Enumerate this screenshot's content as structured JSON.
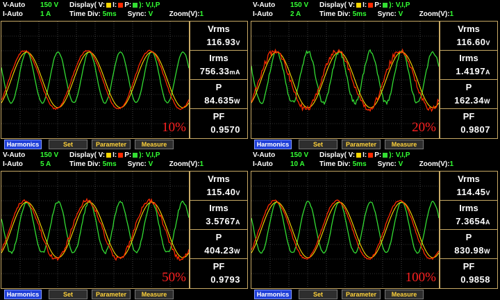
{
  "panels": [
    {
      "v_range_label": "V-Auto",
      "v_range": "150 V",
      "i_range_label": "I-Auto",
      "i_range": "1 A",
      "display_label": "Display( V:",
      "display_i": "I:",
      "display_p": "P:",
      "display_value": "): V,I,P",
      "timediv_label": "Time Div:",
      "timediv": "5ms",
      "sync_label": "Sync:",
      "sync": "V",
      "zoom_label": "Zoom(V):",
      "zoom": "1",
      "load_percent": "10%",
      "vrms_label": "Vrms",
      "vrms": "116.93",
      "vrms_unit": "V",
      "irms_label": "Irms",
      "irms": "756.33",
      "irms_unit": "mA",
      "p_label": "P",
      "p": "84.635",
      "p_unit": "W",
      "pf_label": "PF",
      "pf": "0.9570",
      "buttons": [
        "Harmonics",
        "Set",
        "Parameter",
        "Measure"
      ]
    },
    {
      "v_range_label": "V-Auto",
      "v_range": "150 V",
      "i_range_label": "I-Auto",
      "i_range": "2 A",
      "display_label": "Display( V:",
      "display_i": "I:",
      "display_p": "P:",
      "display_value": "): V,I,P",
      "timediv_label": "Time Div:",
      "timediv": "5ms",
      "sync_label": "Sync:",
      "sync": "V",
      "zoom_label": "Zoom(V):",
      "zoom": "1",
      "load_percent": "20%",
      "vrms_label": "Vrms",
      "vrms": "116.60",
      "vrms_unit": "V",
      "irms_label": "Irms",
      "irms": "1.4197",
      "irms_unit": "A",
      "p_label": "P",
      "p": "162.34",
      "p_unit": "W",
      "pf_label": "PF",
      "pf": "0.9807",
      "buttons": [
        "Harmonics",
        "Set",
        "Parameter",
        "Measure"
      ]
    },
    {
      "v_range_label": "V-Auto",
      "v_range": "150 V",
      "i_range_label": "I-Auto",
      "i_range": "5 A",
      "display_label": "Display( V:",
      "display_i": "I:",
      "display_p": "P:",
      "display_value": "): V,I,P",
      "timediv_label": "Time Div:",
      "timediv": "5ms",
      "sync_label": "Sync:",
      "sync": "V",
      "zoom_label": "Zoom(V):",
      "zoom": "1",
      "load_percent": "50%",
      "vrms_label": "Vrms",
      "vrms": "115.40",
      "vrms_unit": "V",
      "irms_label": "Irms",
      "irms": "3.5767",
      "irms_unit": "A",
      "p_label": "P",
      "p": "404.23",
      "p_unit": "W",
      "pf_label": "PF",
      "pf": "0.9793",
      "buttons": [
        "Harmonics",
        "Set",
        "Parameter",
        "Measure"
      ]
    },
    {
      "v_range_label": "V-Auto",
      "v_range": "150 V",
      "i_range_label": "I-Auto",
      "i_range": "10 A",
      "display_label": "Display( V:",
      "display_i": "I:",
      "display_p": "P:",
      "display_value": "): V,I,P",
      "timediv_label": "Time Div:",
      "timediv": "5ms",
      "sync_label": "Sync:",
      "sync": "V",
      "zoom_label": "Zoom(V):",
      "zoom": "1",
      "load_percent": "100%",
      "vrms_label": "Vrms",
      "vrms": "114.45",
      "vrms_unit": "V",
      "irms_label": "Irms",
      "irms": "7.3654",
      "irms_unit": "A",
      "p_label": "P",
      "p": "830.98",
      "p_unit": "W",
      "pf_label": "PF",
      "pf": "0.9858",
      "buttons": [
        "Harmonics",
        "Set",
        "Parameter",
        "Measure"
      ]
    }
  ],
  "colors": {
    "voltage_trace": "#ffd800",
    "current_trace": "#ff2a00",
    "power_trace": "#33dd33",
    "grid": "#6a6a6a",
    "frame": "#c8aa66",
    "active_button": "#1f3fd8"
  }
}
